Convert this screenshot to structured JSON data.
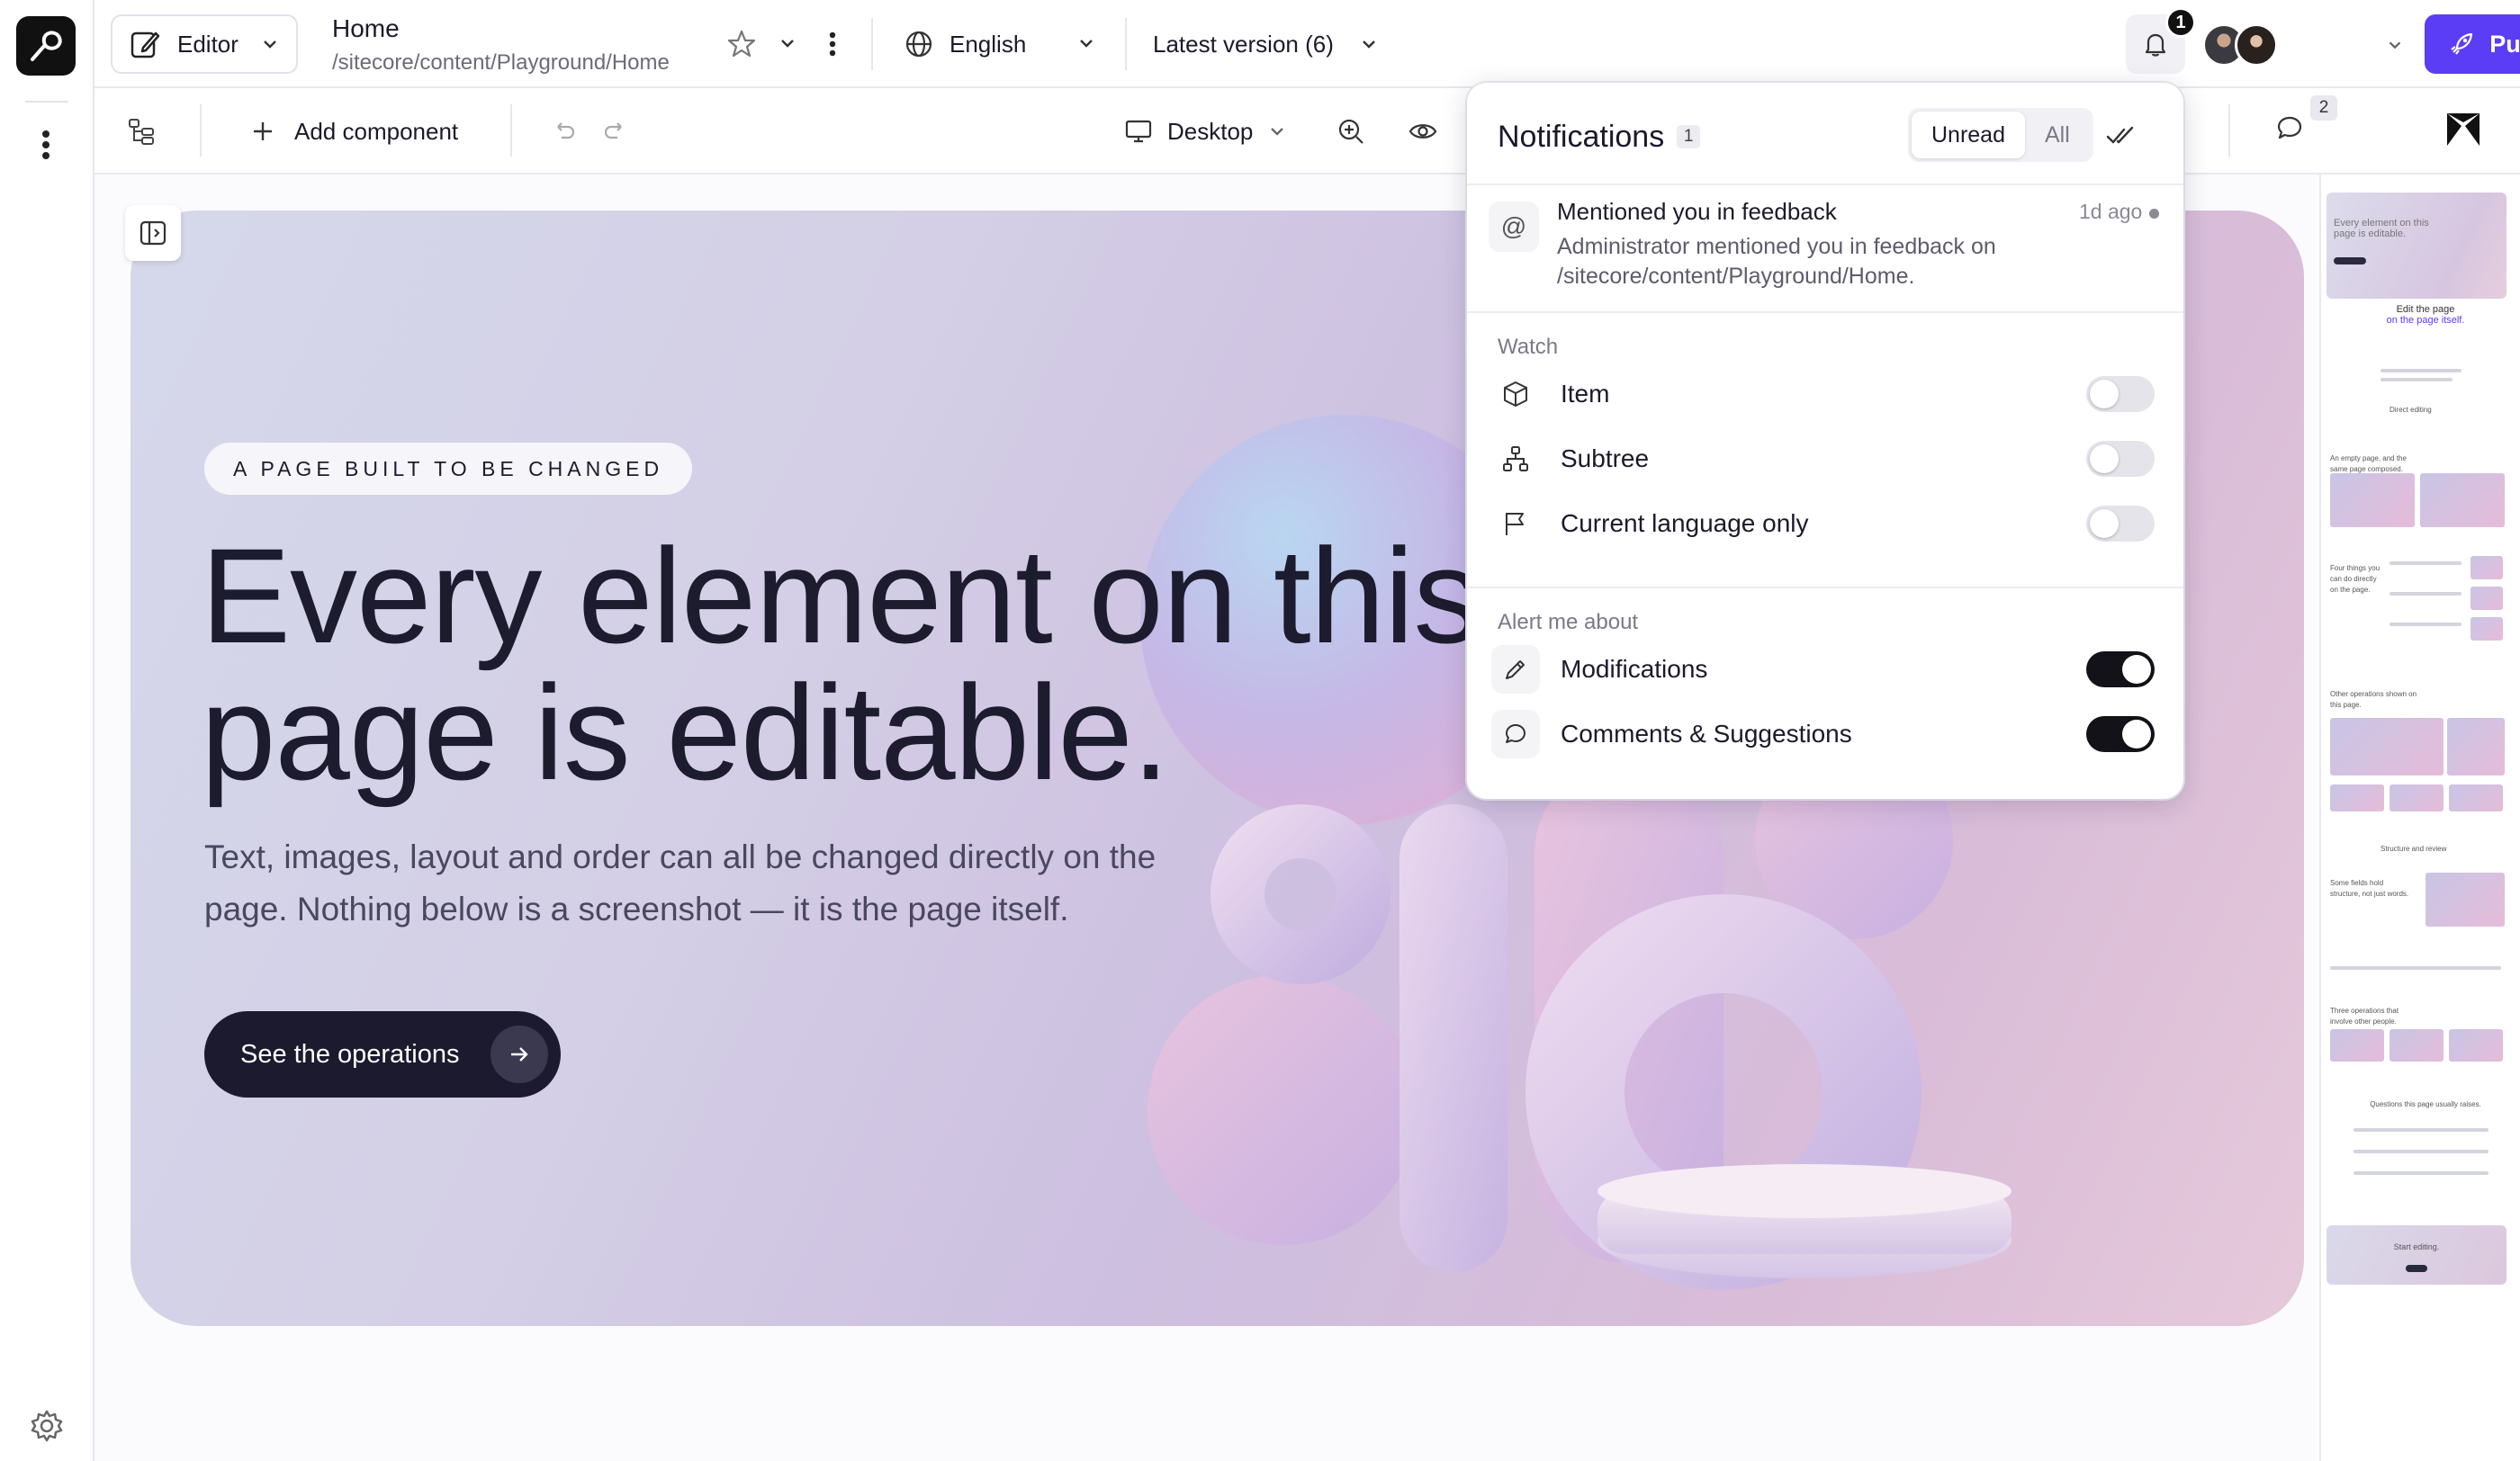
{
  "topbar": {
    "mode": "Editor",
    "page_title": "Home",
    "page_path": "/sitecore/content/Playground/Home",
    "language": "English",
    "version": "Latest version (6)",
    "notification_count": "1",
    "publish_label": "Publish"
  },
  "toolbar": {
    "add_component": "Add component",
    "device": "Desktop",
    "comments_count": "2"
  },
  "hero": {
    "eyebrow": "A PAGE BUILT TO BE CHANGED",
    "heading_line1": "Every element on this",
    "heading_line2": "page is editable.",
    "subtext": "Text, images, layout and order can all be changed directly on the page. Nothing below is a screenshot — it is the page itself.",
    "cta": "See the operations"
  },
  "thumbnails": {
    "hero_text": "Every element on this page is editable.",
    "t1": "Edit the page",
    "t1b": "on the page itself.",
    "t2": "Direct editing",
    "t3": "An empty page, and the same page composed.",
    "t4": "Four things you can do directly on the page.",
    "t5": "Other operations shown on this page.",
    "t6": "Structure and review",
    "t7": "Some fields hold structure, not just words.",
    "t8": "Three operations that involve other people.",
    "t9": "Questions this page usually raises.",
    "t10": "Start editing."
  },
  "notifications": {
    "title": "Notifications",
    "count": "1",
    "filter_unread": "Unread",
    "filter_all": "All",
    "items": [
      {
        "title": "Mentioned you in feedback",
        "time": "1d ago",
        "body": "Administrator mentioned you in feedback on /sitecore/content/Playground/Home."
      }
    ],
    "watch_label": "Watch",
    "watch": [
      {
        "label": "Item",
        "on": false
      },
      {
        "label": "Subtree",
        "on": false
      },
      {
        "label": "Current language only",
        "on": false
      }
    ],
    "alert_label": "Alert me about",
    "alerts": [
      {
        "label": "Modifications",
        "on": true
      },
      {
        "label": "Comments & Suggestions",
        "on": true
      }
    ]
  },
  "colors": {
    "publish": "#5b3df5",
    "toggle_on": "#121218",
    "toggle_off": "#e4e4ea",
    "cta": "#1b1a2e"
  }
}
